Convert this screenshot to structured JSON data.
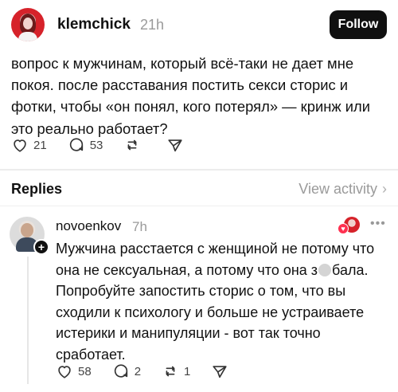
{
  "post": {
    "username": "klemchick",
    "time": "21h",
    "follow_label": "Follow",
    "text": "вопрос к мужчинам, который всё-таки не дает мне покоя. после расставания постить секси сторис и фотки, чтобы «он понял, кого потерял» — кринж или это реально работает?",
    "actions": {
      "likes": "21",
      "comments": "53",
      "reposts": "",
      "share": ""
    },
    "icons": [
      "heart-icon",
      "comment-icon",
      "repost-icon",
      "share-icon"
    ]
  },
  "replies_header": {
    "title": "Replies",
    "view_activity": "View activity",
    "chevron": "›"
  },
  "reply": {
    "username": "novoenkov",
    "time": "7h",
    "plus": "+",
    "more": "•••",
    "text_before": "Мужчина расстается с женщиной не потому что она не сексуальная, а потому что она з",
    "text_after": "бала. Попробуйте запостить сторис о том, что вы сходили к психологу и больше не устраиваете истерики и манипуляции -  вот так точно сработает.",
    "actions": {
      "likes": "58",
      "comments": "2",
      "reposts": "1",
      "share": ""
    }
  },
  "colors": {
    "follow_bg": "#101010",
    "muted": "#9a9a9a",
    "like_badge": "#ff3050"
  }
}
